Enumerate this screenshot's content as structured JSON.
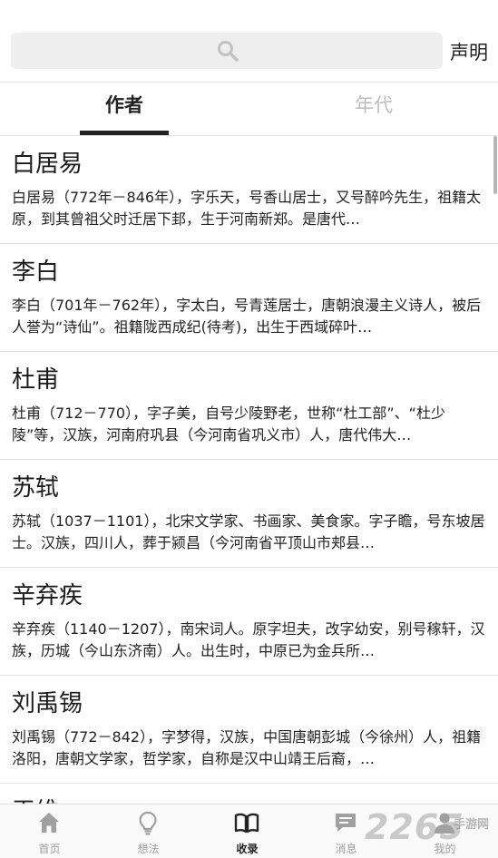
{
  "header": {
    "search_icon": "search-icon",
    "declare_label": "声明"
  },
  "tabs": [
    {
      "label": "作者",
      "active": true
    },
    {
      "label": "年代",
      "active": false
    }
  ],
  "authors": [
    {
      "name": "白居易",
      "desc": "白居易（772年－846年），字乐天，号香山居士，又号醉吟先生，祖籍太原，到其曾祖父时迁居下邽，生于河南新郑。是唐代…"
    },
    {
      "name": "李白",
      "desc": "李白（701年－762年），字太白，号青莲居士，唐朝浪漫主义诗人，被后人誉为“诗仙”。祖籍陇西成纪(待考)，出生于西域碎叶…"
    },
    {
      "name": "杜甫",
      "desc": "杜甫（712－770），字子美，自号少陵野老，世称“杜工部”、“杜少陵”等，汉族，河南府巩县（今河南省巩义市）人，唐代伟大…"
    },
    {
      "name": "苏轼",
      "desc": "苏轼（1037－1101），北宋文学家、书画家、美食家。字子瞻，号东坡居士。汉族，四川人，葬于颍昌（今河南省平顶山市郏县…"
    },
    {
      "name": "辛弃疾",
      "desc": "辛弃疾（1140－1207），南宋词人。原字坦夫，改字幼安，别号稼轩，汉族，历城（今山东济南）人。出生时，中原已为金兵所…"
    },
    {
      "name": "刘禹锡",
      "desc": "刘禹锡（772－842），字梦得，汉族，中国唐朝彭城（今徐州）人，祖籍洛阳，唐朝文学家，哲学家，自称是汉中山靖王后裔，…"
    },
    {
      "name": "王维",
      "desc": ""
    }
  ],
  "bottom_nav": [
    {
      "label": "首页",
      "icon": "home-icon",
      "active": false
    },
    {
      "label": "想法",
      "icon": "lightbulb-icon",
      "active": false
    },
    {
      "label": "收录",
      "icon": "book-icon",
      "active": true
    },
    {
      "label": "消息",
      "icon": "message-icon",
      "active": false
    },
    {
      "label": "我的",
      "icon": "person-icon",
      "active": false
    }
  ],
  "watermark": {
    "text": "2265",
    "sub": "手游网"
  }
}
